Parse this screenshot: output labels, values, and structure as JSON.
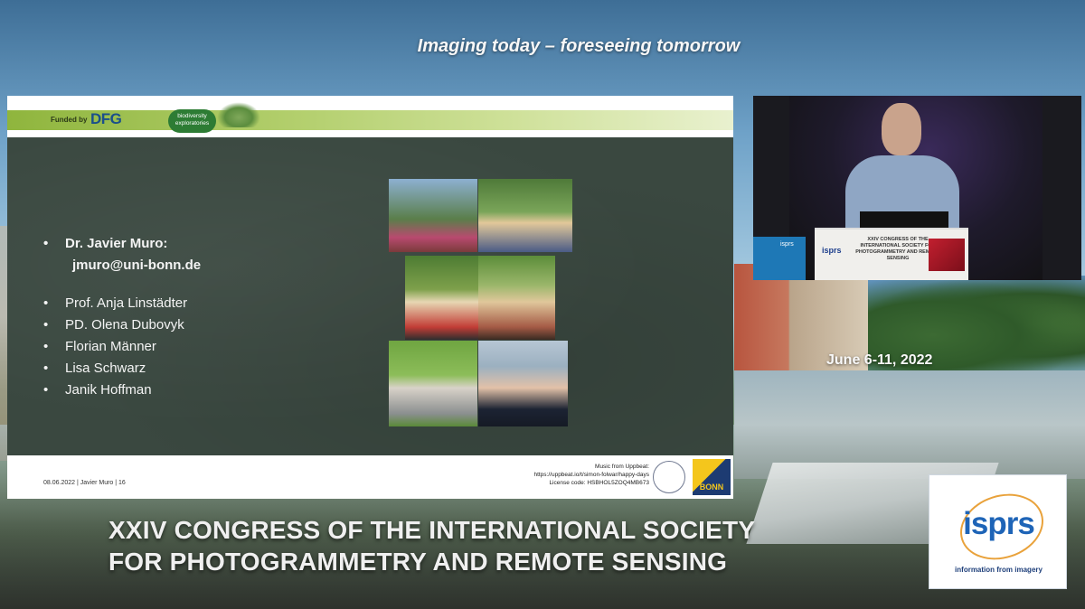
{
  "slogan": "Imaging today – foreseeing tomorrow",
  "slide": {
    "header": {
      "funded_by": "Funded by",
      "dfg": "DFG",
      "bio_logo": "biodiversity exploratories"
    },
    "main_name": "Dr. Javier Muro:",
    "email": "jmuro@uni-bonn.de",
    "team": [
      "Prof. Anja Linstädter",
      "PD. Olena Dubovyk",
      "Florian Männer",
      "Lisa Schwarz",
      "Janik Hoffman"
    ],
    "footer": {
      "left": "08.06.2022  | Javier Muro  |  16",
      "music_line1": "Music from Uppbeat:",
      "music_line2": "https://uppbeat.io/t/simon-folwar/happy-days",
      "music_line3": "License code: HSBHOL5ZOQ4MB673",
      "bonn": "BONN"
    }
  },
  "video": {
    "podium_brand": "isprs",
    "podium_text": "XXIV CONGRESS OF THE INTERNATIONAL SOCIETY FOR PHOTOGRAMMETRY AND REMOTE SENSING",
    "side_screen": "isprs"
  },
  "dates": "June 6-11, 2022",
  "isprs": {
    "word": "isprs",
    "tagline": "information from imagery"
  },
  "congress": {
    "line1": "XXIV CONGRESS OF THE INTERNATIONAL SOCIETY",
    "line2": "FOR PHOTOGRAMMETRY AND REMOTE SENSING"
  }
}
